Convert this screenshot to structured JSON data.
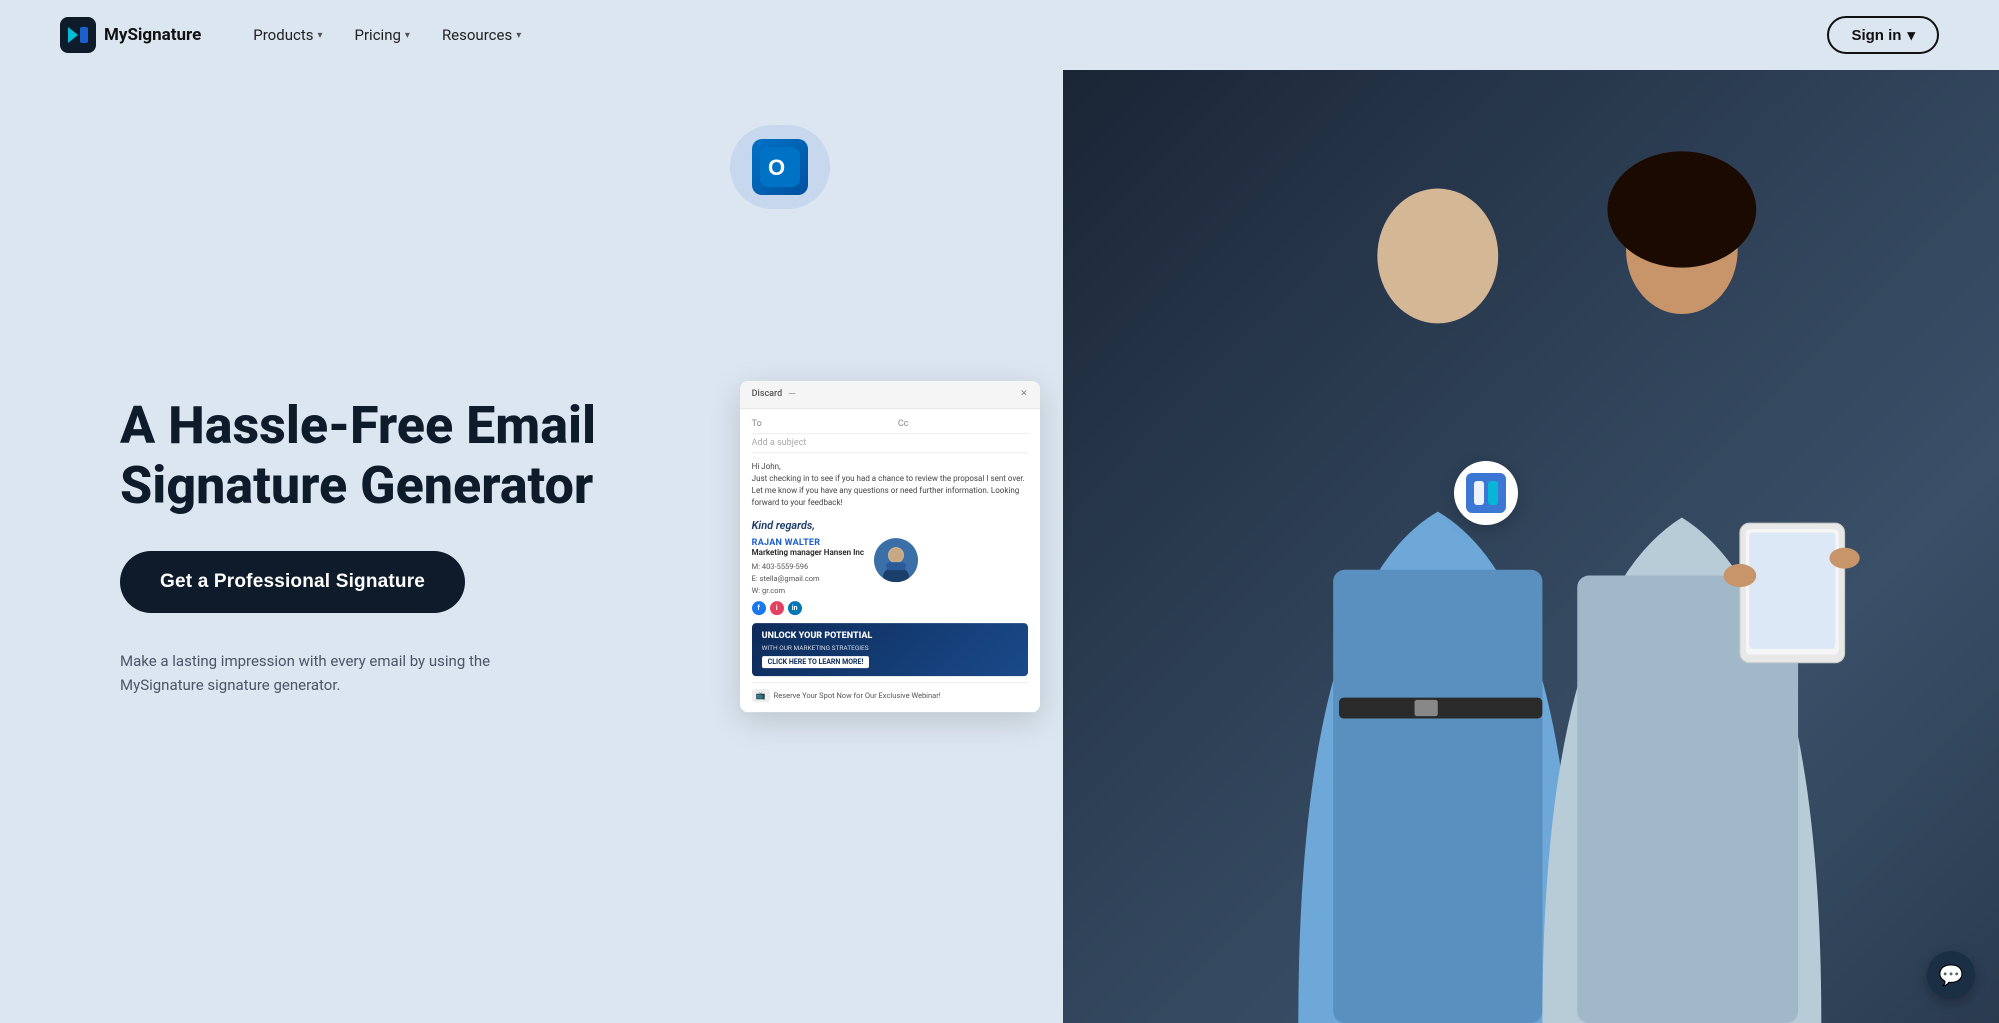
{
  "brand": {
    "name": "MySignature",
    "logo_colors": [
      "#00bcd4",
      "#1a5fcc"
    ]
  },
  "nav": {
    "links": [
      {
        "label": "Products",
        "has_dropdown": true
      },
      {
        "label": "Pricing",
        "has_dropdown": true
      },
      {
        "label": "Resources",
        "has_dropdown": true
      }
    ],
    "signin_label": "Sign in",
    "signin_has_dropdown": true
  },
  "hero": {
    "title": "A Hassle-Free Email Signature Generator",
    "cta_label": "Get a Professional Signature",
    "subtitle": "Make a lasting impression with every email by using the MySignature signature generator."
  },
  "email_preview": {
    "discard_label": "Discard",
    "to_label": "To",
    "subject_placeholder": "Add a subject",
    "body": "Hi John,\nJust checking in to see if you had a chance to review the proposal I sent over. Let me know if you have any questions or need further information. Looking forward to your feedback!",
    "regards": "Kind regards,",
    "sig_name": "RAJAN WALTER",
    "sig_title": "Marketing manager Hansen Inc",
    "sig_phone": "M: 403-5559-596",
    "sig_email": "E: stella@gmail.com",
    "sig_website": "W: gr.com",
    "banner_title": "UNLOCK YOUR POTENTIAL",
    "banner_sub": "WITH OUR MARKETING STRATEGIES",
    "banner_cta": "CLICK HERE TO LEARN MORE!",
    "webinar_text": "Reserve Your Spot Now for Our Exclusive Webinar!"
  },
  "chat": {
    "icon": "💬"
  }
}
